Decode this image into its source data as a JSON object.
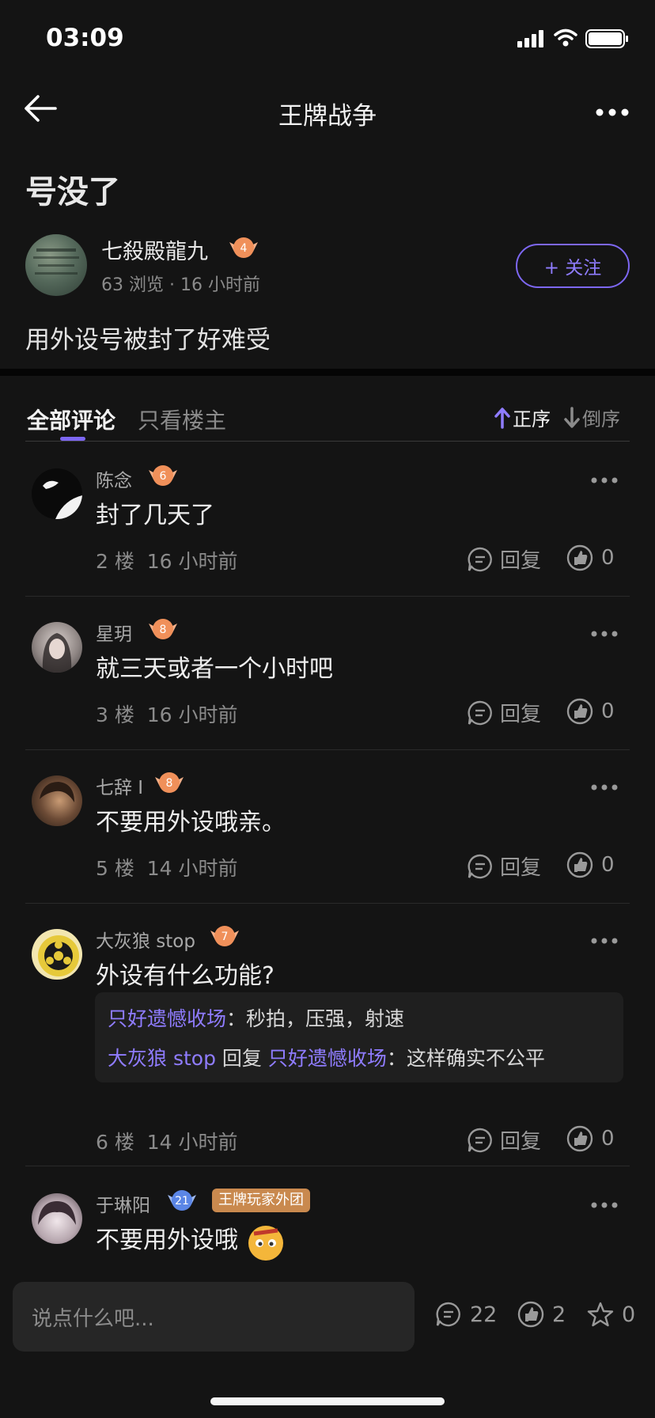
{
  "status": {
    "time": "03:09"
  },
  "nav": {
    "title": "王牌战争"
  },
  "post": {
    "title": "号没了",
    "author": "七殺殿龍九",
    "author_level": "4",
    "views": "63 浏览",
    "time": "16 小时前",
    "follow_label": "+ 关注",
    "body": "用外设号被封了好难受"
  },
  "tabs": {
    "all": "全部评论",
    "owner": "只看楼主"
  },
  "sort": {
    "asc": "正序",
    "desc": "倒序"
  },
  "comments": [
    {
      "name": "陈念",
      "level": "6",
      "text": "封了几天了",
      "floor": "2 楼",
      "time": "16 小时前",
      "reply_label": "回复",
      "likes": "0"
    },
    {
      "name": "星玥",
      "level": "8",
      "text": "就三天或者一个小时吧",
      "floor": "3 楼",
      "time": "16 小时前",
      "reply_label": "回复",
      "likes": "0"
    },
    {
      "name": "七辞 I",
      "level": "8",
      "text": "不要用外设哦亲。",
      "floor": "5 楼",
      "time": "14 小时前",
      "reply_label": "回复",
      "likes": "0"
    },
    {
      "name": "大灰狼 stop",
      "level": "7",
      "text": "外设有什么功能?",
      "floor": "6 楼",
      "time": "14 小时前",
      "reply_label": "回复",
      "likes": "0",
      "replies": [
        {
          "user": "只好遗憾收场",
          "sep": "：",
          "text": "秒拍，压强，射速"
        },
        {
          "user": "大灰狼 stop",
          "mid": "回复",
          "target": "只好遗憾收场",
          "sep": "：",
          "text": "这样确实不公平"
        }
      ]
    },
    {
      "name": "于琳阳",
      "level": "21",
      "tag": "王牌玩家外团",
      "text": "不要用外设哦"
    }
  ],
  "bottom": {
    "placeholder": "说点什么吧...",
    "comments": "22",
    "likes": "2",
    "stars": "0"
  },
  "colors": {
    "accent": "#7d67f2",
    "background": "#141414",
    "badge": "#f0905a",
    "badge_blue": "#5b86e6"
  }
}
